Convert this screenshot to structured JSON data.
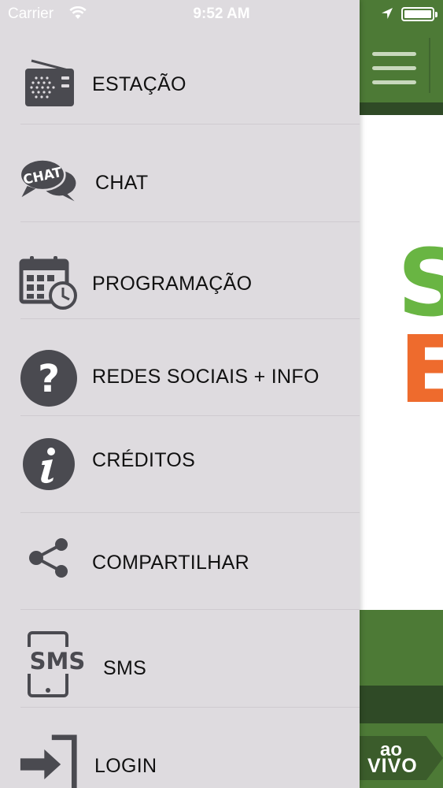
{
  "status_bar": {
    "carrier": "Carrier",
    "time": "9:52 AM",
    "icons": [
      "wifi-icon",
      "location-arrow-icon",
      "battery-icon"
    ]
  },
  "drawer_menu": {
    "items": [
      {
        "label": "ESTAÇÃO",
        "icon": "radio-icon"
      },
      {
        "label": "CHAT",
        "icon": "chat-bubble-icon",
        "icon_text": "CHAT"
      },
      {
        "label": "PROGRAMAÇÃO",
        "icon": "calendar-clock-icon"
      },
      {
        "label": "REDES SOCIAIS + INFO",
        "icon": "question-circle-icon"
      },
      {
        "label": "CRÉDITOS",
        "icon": "info-circle-icon"
      },
      {
        "label": "COMPARTILHAR",
        "icon": "share-icon"
      },
      {
        "label": "SMS",
        "icon": "sms-phone-icon",
        "icon_text": "SMS"
      },
      {
        "label": "LOGIN",
        "icon": "login-arrow-icon"
      }
    ]
  },
  "app_background": {
    "header_icon": "hamburger-menu-icon",
    "logo_partial": [
      "S",
      "E"
    ],
    "live_badge": {
      "line1": "ao",
      "line2": "VIVO"
    }
  },
  "colors": {
    "drawer_background": "#dedbdf",
    "icon_gray": "#4a4a50",
    "header_green": "#4d7a36",
    "dark_green": "#2f4a26",
    "logo_green": "#69b543",
    "logo_orange": "#ee6b2d"
  }
}
